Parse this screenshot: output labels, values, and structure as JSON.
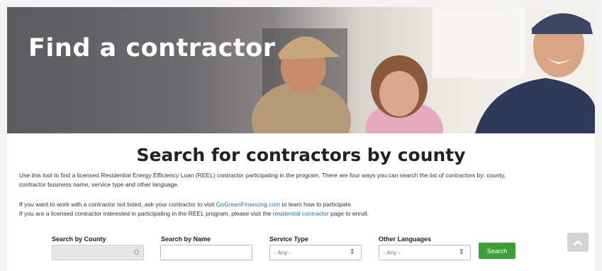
{
  "hero": {
    "title": "Find a contractor"
  },
  "main": {
    "heading": "Search for contractors by county",
    "intro": "Use this tool to find a licensed Residential Energy Efficiency Loan (REEL) contractor participating in the program. There are four ways you can search the list of contractors by: county, contractor business name, service type and other language.",
    "line2_pre": "If you want to work with a contractor not listed, ask your contractor to visit ",
    "line2_link": "GoGreenFinancing.com",
    "line2_post": " to learn how to participate.",
    "line3_pre": "If you are a licensed contractor interested in participating in the REEL program, please visit the ",
    "line3_link": "residential contractor",
    "line3_post": " page to enroll."
  },
  "filters": {
    "county_label": "Search by County",
    "county_value": "",
    "name_label": "Search by Name",
    "name_value": "",
    "service_label": "Service Type",
    "service_value": "- Any -",
    "language_label": "Other Languages",
    "language_value": "- Any -",
    "search_button": "Search"
  },
  "icons": {
    "back_to_top": "chevron-up-icon",
    "select_arrows": "up-down-chevron-icon",
    "loading": "spinner-ring-icon"
  },
  "colors": {
    "search_button": "#3e9e3a",
    "link": "#2a6ea8",
    "hero_title": "#ffffff"
  }
}
